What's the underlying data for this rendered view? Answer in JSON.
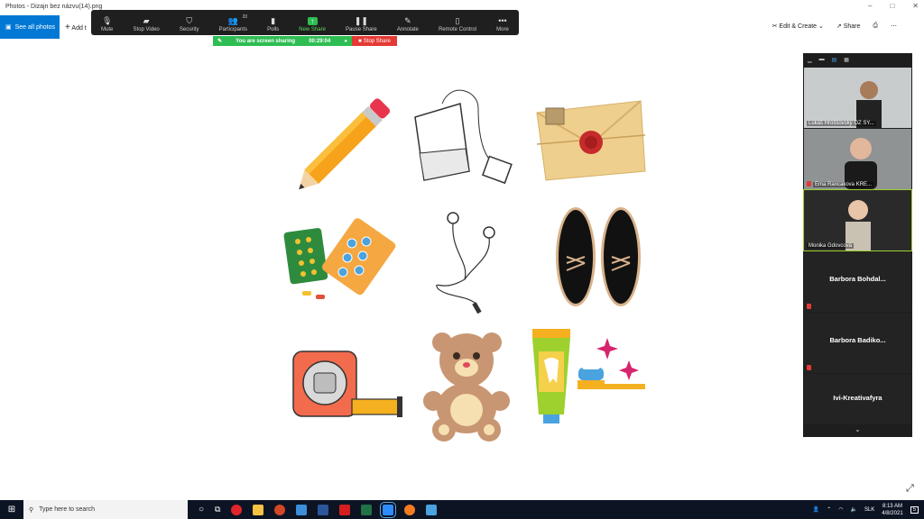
{
  "window": {
    "title": "Photos - Dizajn bez názvu(14).png",
    "controls": [
      "–",
      "□",
      "✕"
    ]
  },
  "appbar": {
    "see_all": "See all photos",
    "add_to": "Add t",
    "edit_create": "Edit & Create",
    "share": "Share"
  },
  "zoom": {
    "items": [
      {
        "label": "Mute",
        "icon": "microphone-icon",
        "glyph": "🎙"
      },
      {
        "label": "Stop Video",
        "icon": "video-camera-icon",
        "glyph": "▰"
      },
      {
        "label": "Security",
        "icon": "shield-icon",
        "glyph": "⛉"
      },
      {
        "label": "Participants",
        "icon": "people-icon",
        "glyph": "👥",
        "count": "20"
      },
      {
        "label": "Polls",
        "icon": "bar-chart-icon",
        "glyph": "▮"
      },
      {
        "label": "New Share",
        "icon": "share-arrow-icon",
        "glyph": "↑"
      },
      {
        "label": "Pause Share",
        "icon": "pause-icon",
        "glyph": "❚❚"
      },
      {
        "label": "Annotate",
        "icon": "pencil-icon",
        "glyph": "✎"
      },
      {
        "label": "Remote Control",
        "icon": "mouse-icon",
        "glyph": "▯"
      },
      {
        "label": "More",
        "icon": "more-dots-icon",
        "glyph": "•••"
      }
    ],
    "sharing_text": "You are screen sharing",
    "timer": "00:29:04",
    "stop_share": "Stop Share"
  },
  "panel": {
    "tiles": [
      {
        "name": "Lukáš Hroššovský  OZ SY...",
        "type": "video"
      },
      {
        "name": "Ema Rancakova KRE...",
        "type": "video",
        "muted": true
      },
      {
        "name": "Monika Gdovcova",
        "type": "video",
        "active": true
      },
      {
        "name": "Barbora  Bohdal...",
        "type": "name",
        "muted": true
      },
      {
        "name": "Barbora  Badiko...",
        "type": "name",
        "muted": true
      },
      {
        "name": "Ivi-Kreativafyra",
        "type": "name"
      }
    ]
  },
  "taskbar": {
    "search_placeholder": "Type here to search",
    "language": "SLK",
    "time": "8:13 AM",
    "date": "4/8/2021",
    "notifications": "5"
  }
}
